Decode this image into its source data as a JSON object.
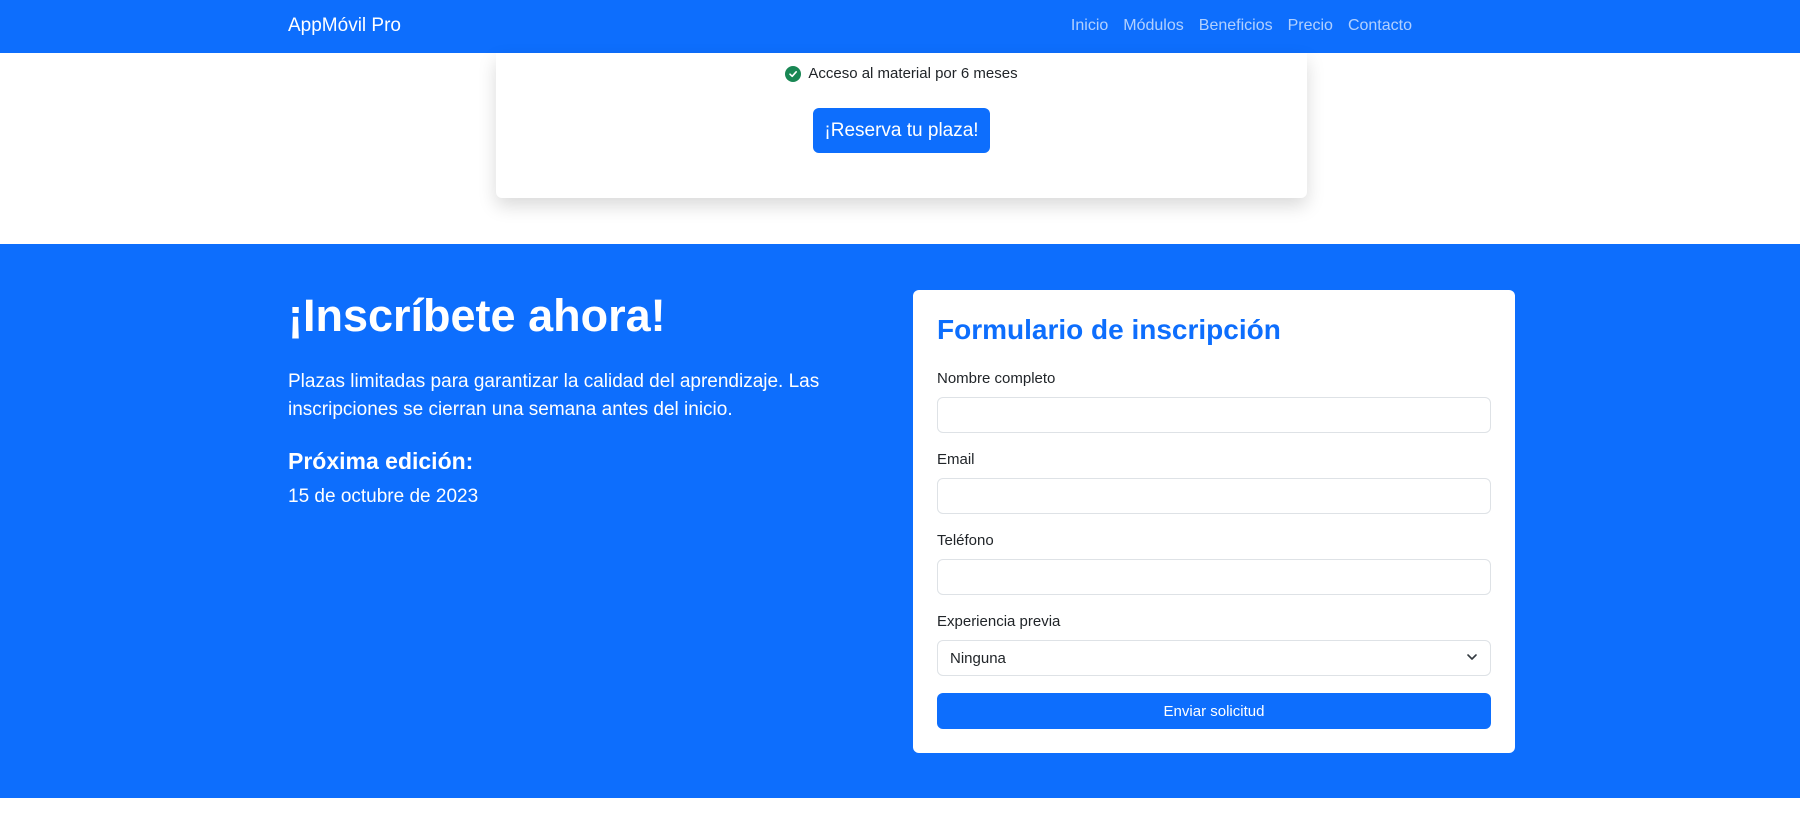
{
  "navbar": {
    "brand": "AppMóvil Pro",
    "links": [
      "Inicio",
      "Módulos",
      "Beneficios",
      "Precio",
      "Contacto"
    ]
  },
  "pricing": {
    "feature": "Acceso al material por 6 meses",
    "button": "¡Reserva tu plaza!"
  },
  "enroll": {
    "title": "¡Inscríbete ahora!",
    "description": "Plazas limitadas para garantizar la calidad del aprendizaje. Las inscripciones se cierran una semana antes del inicio.",
    "edition_title": "Próxima edición:",
    "edition_date": "15 de octubre de 2023"
  },
  "form": {
    "title": "Formulario de inscripción",
    "name_label": "Nombre completo",
    "name_value": "",
    "email_label": "Email",
    "email_value": "",
    "phone_label": "Teléfono",
    "phone_value": "",
    "experience_label": "Experiencia previa",
    "experience_value": "Ninguna",
    "submit": "Enviar solicitud"
  },
  "colors": {
    "primary": "#0d6efd",
    "success": "#198754"
  },
  "icons": [
    "check-circle-icon",
    "chevron-down-icon"
  ]
}
